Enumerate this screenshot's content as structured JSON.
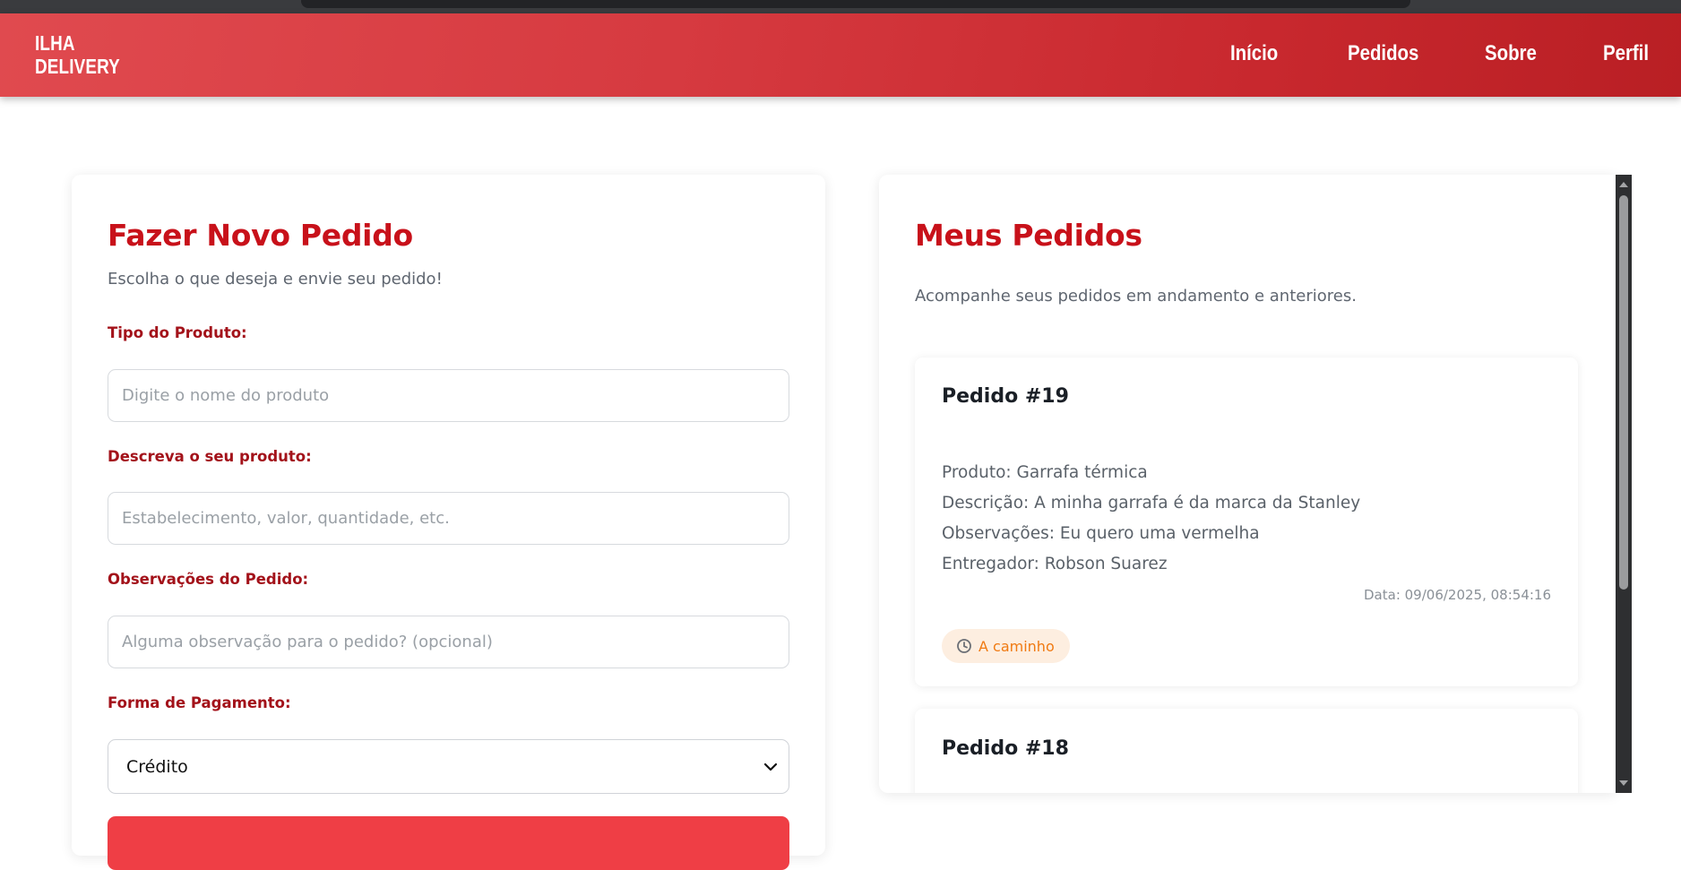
{
  "brand": {
    "line1": "ILHA",
    "line2": "DELIVERY"
  },
  "nav": {
    "inicio": "Início",
    "pedidos": "Pedidos",
    "sobre": "Sobre",
    "perfil": "Perfil"
  },
  "new_order": {
    "title": "Fazer Novo Pedido",
    "subtitle": "Escolha o que deseja e envie seu pedido!",
    "product_type_label": "Tipo do Produto:",
    "product_type_placeholder": "Digite o nome do produto",
    "description_label": "Descreva o seu produto:",
    "description_placeholder": "Estabelecimento, valor, quantidade, etc.",
    "notes_label": "Observações do Pedido:",
    "notes_placeholder": "Alguma observação para o pedido? (opcional)",
    "payment_label": "Forma de Pagamento:",
    "payment_selected": "Crédito"
  },
  "my_orders": {
    "title": "Meus Pedidos",
    "subtitle": "Acompanhe seus pedidos em andamento e anteriores.",
    "orders": [
      {
        "title": "Pedido #19",
        "produto": "Produto: Garrafa térmica",
        "descricao": "Descrição: A minha garrafa é da marca da Stanley",
        "observacoes": "Observações: Eu quero uma vermelha",
        "entregador": "Entregador: Robson Suarez",
        "data": "Data: 09/06/2025, 08:54:16",
        "status": "A caminho"
      },
      {
        "title": "Pedido #18"
      }
    ]
  },
  "colors": {
    "brand_red": "#c8111a",
    "label_red": "#a3121a",
    "button_red": "#ef3e45",
    "status_orange": "#f07a12",
    "status_bg": "#fdeee0"
  },
  "icons": {
    "status": "clock-icon",
    "select": "chevron-down-icon"
  }
}
